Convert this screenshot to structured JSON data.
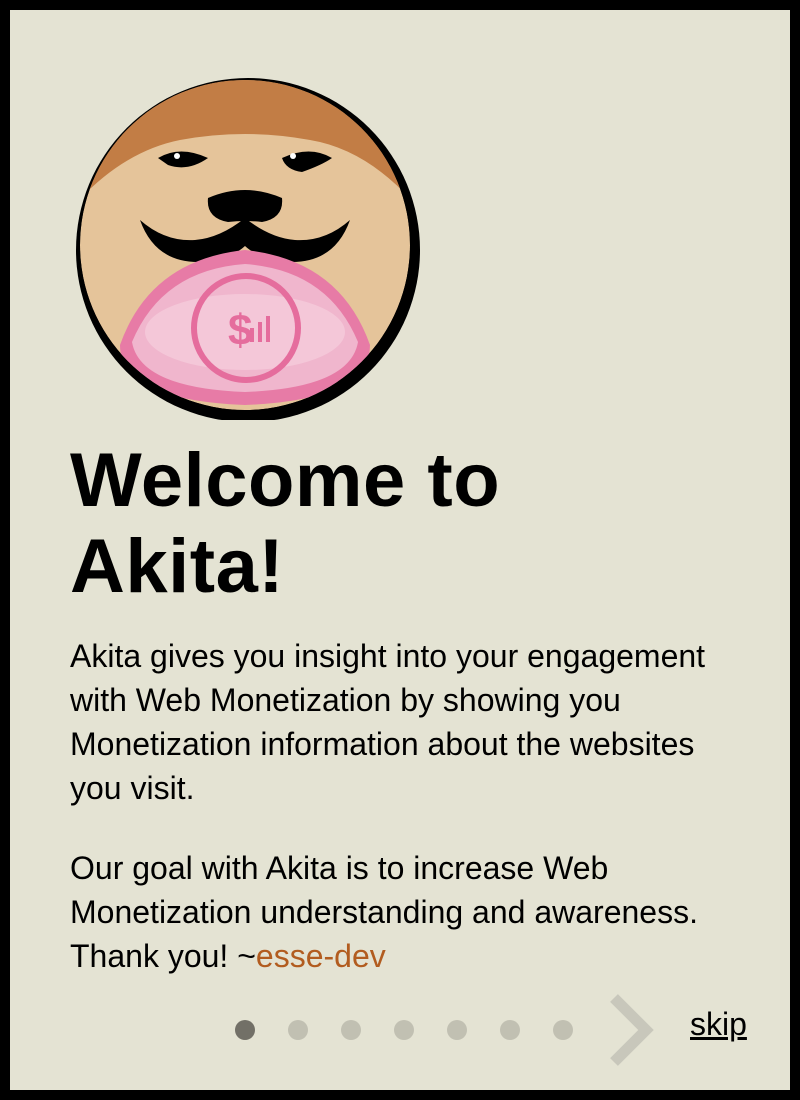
{
  "onboarding": {
    "title": "Welcome to Akita!",
    "paragraph1": "Akita gives you insight into your engagement with Web Monetization by showing you Monetization information about the websites you visit.",
    "paragraph2_prefix": "Our goal with Akita is to increase Web Monetization understanding and awareness. Thank you! ~",
    "author": "esse-dev",
    "skip_label": "skip",
    "total_pages": 7,
    "current_page": 1
  },
  "colors": {
    "background": "#e4e3d3",
    "author_link": "#b25c1f",
    "dot_active": "#727067",
    "dot_inactive": "#c1c0b2",
    "logo_pink": "#ee8ab1"
  }
}
